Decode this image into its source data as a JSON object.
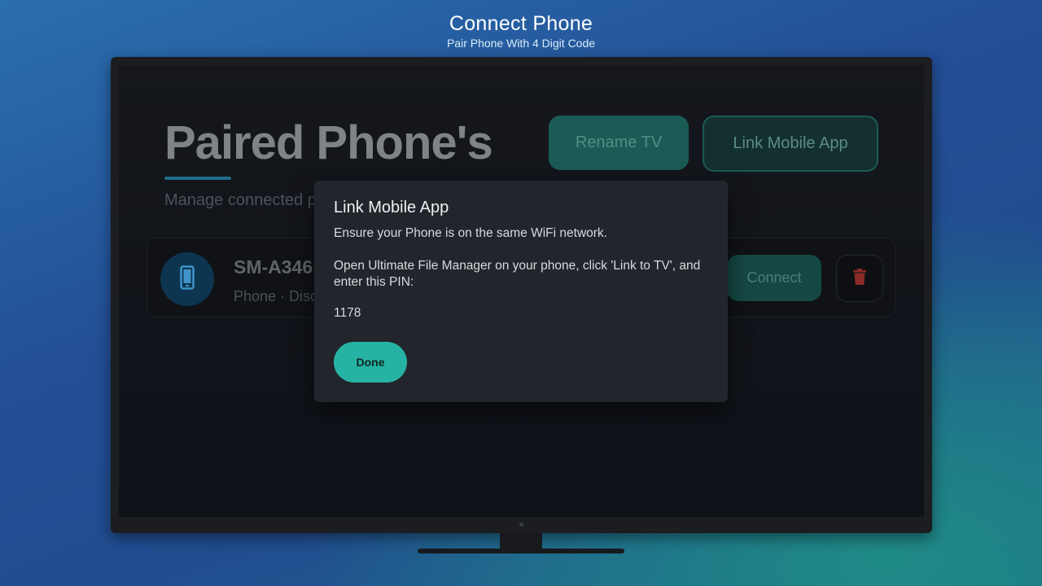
{
  "header": {
    "title": "Connect Phone",
    "subtitle": "Pair Phone With 4 Digit Code"
  },
  "screen": {
    "page_title": "Paired Phone's",
    "page_subtitle": "Manage connected p",
    "rename_button": "Rename TV",
    "link_button": "Link Mobile App",
    "device": {
      "name": "SM-A346",
      "meta": "Phone · Disc",
      "connect_button": "Connect"
    }
  },
  "dialog": {
    "title": "Link Mobile App",
    "line1": "Ensure your Phone is on the same WiFi network.",
    "line2": "Open Ultimate File Manager on your phone, click 'Link to TV', and enter this PIN:",
    "pin": "1178",
    "done_button": "Done"
  },
  "colors": {
    "accent": "#26b3a3",
    "delete": "#c23b36",
    "phone_icon": "#3f95c9"
  },
  "icons": [
    "phone-icon",
    "trash-icon"
  ]
}
